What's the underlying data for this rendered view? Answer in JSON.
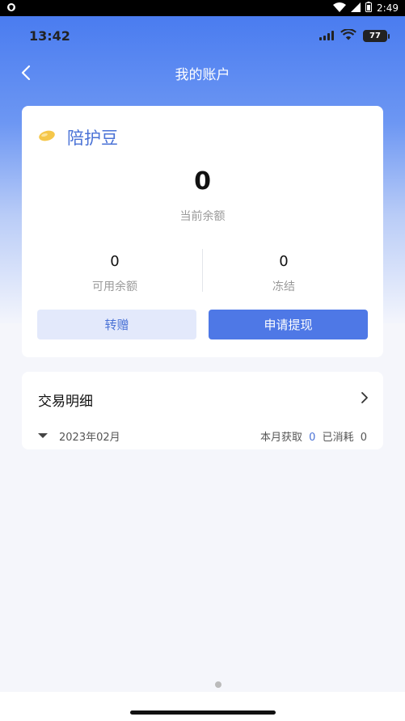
{
  "android_status": {
    "time": "2:49"
  },
  "ios_status": {
    "time": "13:42",
    "battery": "77"
  },
  "nav": {
    "title": "我的账户"
  },
  "balance_card": {
    "name": "陪护豆",
    "balance": "0",
    "balance_label": "当前余额",
    "available_value": "0",
    "available_label": "可用余额",
    "frozen_value": "0",
    "frozen_label": "冻结",
    "transfer_label": "转赠",
    "withdraw_label": "申请提现"
  },
  "transactions": {
    "title": "交易明细",
    "month": "2023年02月",
    "earned_label": "本月获取",
    "earned_value": "0",
    "consumed_label": "已消耗",
    "consumed_value": "0"
  },
  "colors": {
    "accent": "#4e78e6",
    "gradient_top": "#4a7cf0",
    "page_bg": "#f5f6fb"
  },
  "icons": {
    "back": "chevron-left-icon",
    "bean": "bean-icon",
    "arrow": "chevron-right-icon"
  }
}
